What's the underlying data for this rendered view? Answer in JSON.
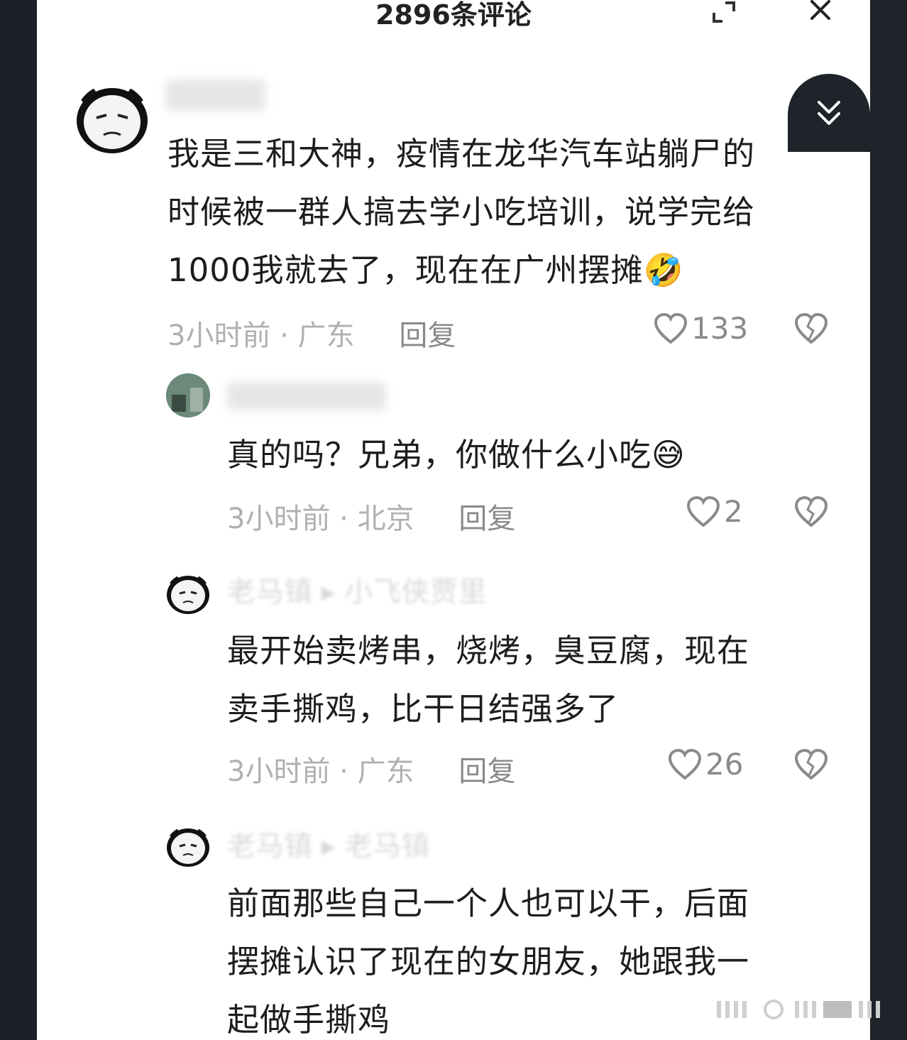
{
  "header": {
    "title": "2896条评论"
  },
  "comments": [
    {
      "text_lines": [
        "我是三和大神，疫情在龙华汽车站躺尸的",
        "时候被一群人搞去学小吃培训，说学完给",
        "1000我就去了，现在在广州摆摊"
      ],
      "emoji": "🤣",
      "time": "3小时前",
      "location": "广东",
      "reply": "回复",
      "likes": "133"
    },
    {
      "text_lines": [
        "真的吗？兄弟，你做什么小吃"
      ],
      "emoji": "😅",
      "time": "3小时前",
      "location": "北京",
      "reply": "回复",
      "likes": "2"
    },
    {
      "name_partial": "老马镇 ▸ 小飞侠贾里",
      "text_lines": [
        "最开始卖烤串，烧烤，臭豆腐，现在",
        "卖手撕鸡，比干日结强多了"
      ],
      "time": "3小时前",
      "location": "广东",
      "reply": "回复",
      "likes": "26"
    },
    {
      "name_partial": "老马镇 ▸ 老马镇",
      "text_lines": [
        "前面那些自己一个人也可以干，后面",
        "摆摊认识了现在的女朋友，她跟我一",
        "起做手撕鸡"
      ]
    }
  ],
  "separator": "·",
  "icons": {
    "expand": "expand-icon",
    "close": "close-icon",
    "collapse": "double-chevron-down-icon",
    "like": "heart-icon",
    "dislike": "broken-heart-icon"
  }
}
